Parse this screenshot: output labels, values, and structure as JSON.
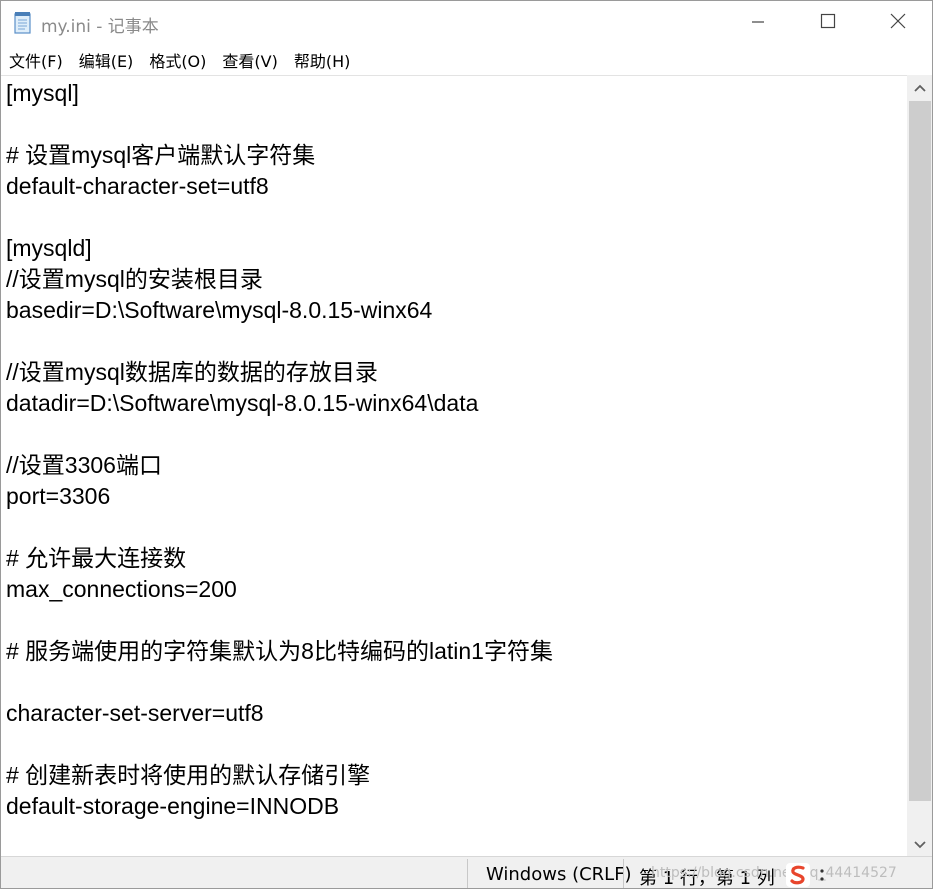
{
  "window": {
    "title": "my.ini - 记事本"
  },
  "menu": {
    "items": [
      {
        "label": "文件(F)"
      },
      {
        "label": "编辑(E)"
      },
      {
        "label": "格式(O)"
      },
      {
        "label": "查看(V)"
      },
      {
        "label": "帮助(H)"
      }
    ]
  },
  "editor": {
    "lines": [
      "[mysql]",
      "",
      "# 设置mysql客户端默认字符集",
      "default-character-set=utf8",
      "",
      "[mysqld]",
      "//设置mysql的安装根目录",
      "basedir=D:\\Software\\mysql-8.0.15-winx64",
      "",
      "//设置mysql数据库的数据的存放目录",
      "datadir=D:\\Software\\mysql-8.0.15-winx64\\data",
      "",
      "//设置3306端口",
      "port=3306",
      "",
      "# 允许最大连接数",
      "max_connections=200",
      "",
      "# 服务端使用的字符集默认为8比特编码的latin1字符集",
      "",
      "character-set-server=utf8",
      "",
      "# 创建新表时将使用的默认存储引擎",
      "default-storage-engine=INNODB"
    ]
  },
  "statusbar": {
    "encoding": "Windows (CRLF)",
    "position": "第 1 行，第 1 列",
    "watermark": "https://blog.csdn.net/qq_44414527"
  },
  "colors": {
    "title_text": "#8a8a8a",
    "scroll_track": "#f0f0f0",
    "scroll_thumb": "#cdcdcd",
    "ime_red": "#e8452c"
  },
  "icons": {
    "app": "notepad-icon",
    "minimize": "minimize-icon",
    "maximize": "maximize-icon",
    "close": "close-icon",
    "scroll_up": "chevron-up-icon",
    "scroll_down": "chevron-down-icon",
    "ime": "sogou-ime-icon"
  }
}
